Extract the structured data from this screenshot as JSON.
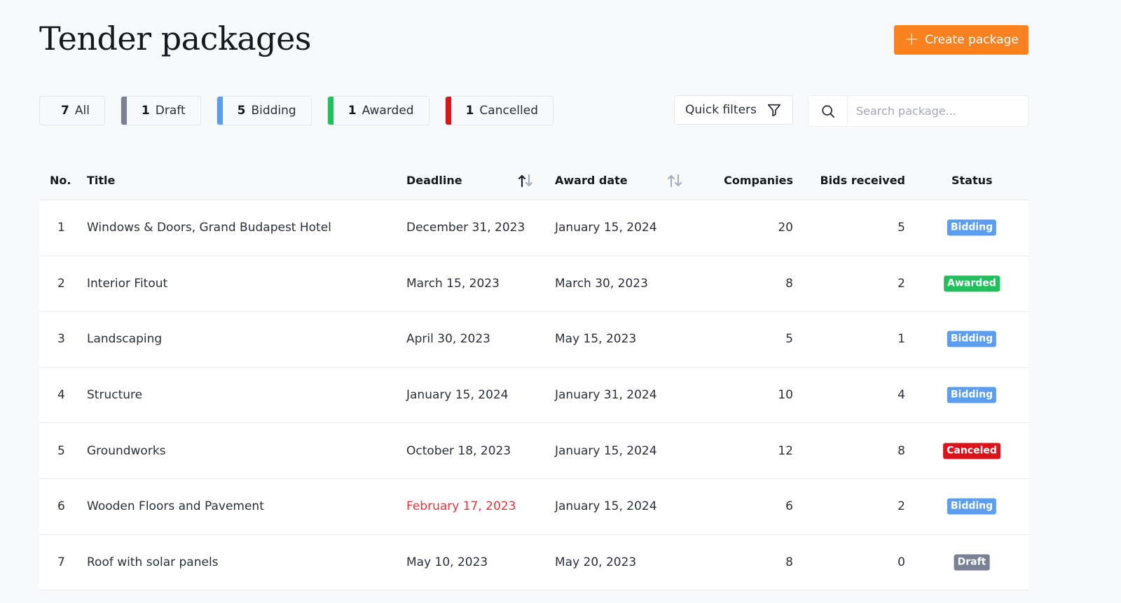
{
  "header": {
    "title": "Tender packages",
    "create_label": "Create package"
  },
  "filters": [
    {
      "count": "7",
      "label": "All",
      "color": ""
    },
    {
      "count": "1",
      "label": "Draft",
      "color": "#7a8194"
    },
    {
      "count": "5",
      "label": "Bidding",
      "color": "#5b9ef0"
    },
    {
      "count": "1",
      "label": "Awarded",
      "color": "#20c05c"
    },
    {
      "count": "1",
      "label": "Cancelled",
      "color": "#d9141c"
    }
  ],
  "quick_filters": {
    "label": "Quick filters",
    "icon": "funnel-icon"
  },
  "search": {
    "placeholder": "Search package...",
    "value": "",
    "icon": "search-icon"
  },
  "table": {
    "columns": [
      "No.",
      "Title",
      "Deadline",
      "Award date",
      "Companies",
      "Bids received",
      "Status"
    ],
    "sort": {
      "deadline": "sort-ascending-icon",
      "award_date": "sort-icon"
    },
    "rows": [
      {
        "no": "1",
        "title": "Windows & Doors, Grand Budapest Hotel",
        "deadline": "December 31, 2023",
        "award_date": "January 15, 2024",
        "companies": "20",
        "bids": "5",
        "status": "Bidding",
        "late": false
      },
      {
        "no": "2",
        "title": "Interior Fitout",
        "deadline": "March 15, 2023",
        "award_date": "March 30, 2023",
        "companies": "8",
        "bids": "2",
        "status": "Awarded",
        "late": false
      },
      {
        "no": "3",
        "title": "Landscaping",
        "deadline": "April 30, 2023",
        "award_date": "May 15, 2023",
        "companies": "5",
        "bids": "1",
        "status": "Bidding",
        "late": false
      },
      {
        "no": "4",
        "title": "Structure",
        "deadline": "January 15, 2024",
        "award_date": "January 31, 2024",
        "companies": "10",
        "bids": "4",
        "status": "Bidding",
        "late": false
      },
      {
        "no": "5",
        "title": "Groundworks",
        "deadline": "October 18, 2023",
        "award_date": "January 15, 2024",
        "companies": "12",
        "bids": "8",
        "status": "Canceled",
        "late": false
      },
      {
        "no": "6",
        "title": "Wooden Floors and Pavement",
        "deadline": "February 17, 2023",
        "award_date": "January 15, 2024",
        "companies": "6",
        "bids": "2",
        "status": "Bidding",
        "late": true
      },
      {
        "no": "7",
        "title": "Roof with solar panels",
        "deadline": "May 10, 2023",
        "award_date": "May 20, 2023",
        "companies": "8",
        "bids": "0",
        "status": "Draft",
        "late": false
      }
    ]
  },
  "status_colors": {
    "Bidding": "#5b9ef0",
    "Awarded": "#20c05c",
    "Canceled": "#d9141c",
    "Draft": "#7a8194"
  },
  "colors": {
    "accent": "#f7821f",
    "overdue": "#e4343b"
  }
}
